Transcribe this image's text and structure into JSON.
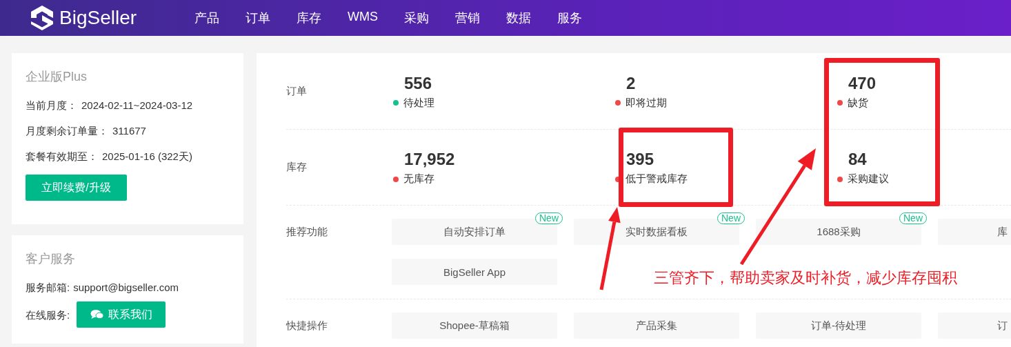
{
  "header": {
    "logo": "BigSeller",
    "nav": [
      "产品",
      "订单",
      "库存",
      "WMS",
      "采购",
      "营销",
      "数据",
      "服务"
    ]
  },
  "plan_card": {
    "title": "企业版Plus",
    "lines": [
      {
        "label": "当前月度：",
        "value": "2024-02-11~2024-03-12"
      },
      {
        "label": "月度剩余订单量：",
        "value": "311677"
      },
      {
        "label": "套餐有效期至：",
        "value": "2025-01-16 (322天)"
      }
    ],
    "button": "立即续费/升级"
  },
  "service_card": {
    "title": "客户服务",
    "email_label": "服务邮箱:",
    "email": "support@bigseller.com",
    "online_label": "在线服务:",
    "button": "联系我们"
  },
  "stats": [
    {
      "label": "订单",
      "items": [
        {
          "value": "556",
          "name": "待处理",
          "color": "#19c08f"
        },
        {
          "value": "2",
          "name": "即将过期",
          "color": "#f04848"
        },
        {
          "value": "470",
          "name": "缺货",
          "color": "#f04848"
        }
      ]
    },
    {
      "label": "库存",
      "items": [
        {
          "value": "17,952",
          "name": "无库存",
          "color": "#f04848"
        },
        {
          "value": "395",
          "name": "低于警戒库存",
          "color": "#f04848"
        },
        {
          "value": "84",
          "name": "采购建议",
          "color": "#f04848"
        }
      ]
    }
  ],
  "recommended": {
    "label": "推荐功能",
    "tiles": [
      {
        "text": "自动安排订单",
        "badge": "New"
      },
      {
        "text": "实时数据看板",
        "badge": "New"
      },
      {
        "text": "1688采购",
        "badge": "New"
      },
      {
        "text": "库"
      },
      {
        "text": "BigSeller App"
      }
    ]
  },
  "shortcuts": {
    "label": "快捷操作",
    "tiles": [
      {
        "text": "Shopee-草稿箱"
      },
      {
        "text": "产品采集"
      },
      {
        "text": "订单-待处理"
      },
      {
        "text": "订"
      }
    ]
  },
  "annotation": {
    "note": "三管齐下，帮助卖家及时补货，减少库存囤积"
  }
}
